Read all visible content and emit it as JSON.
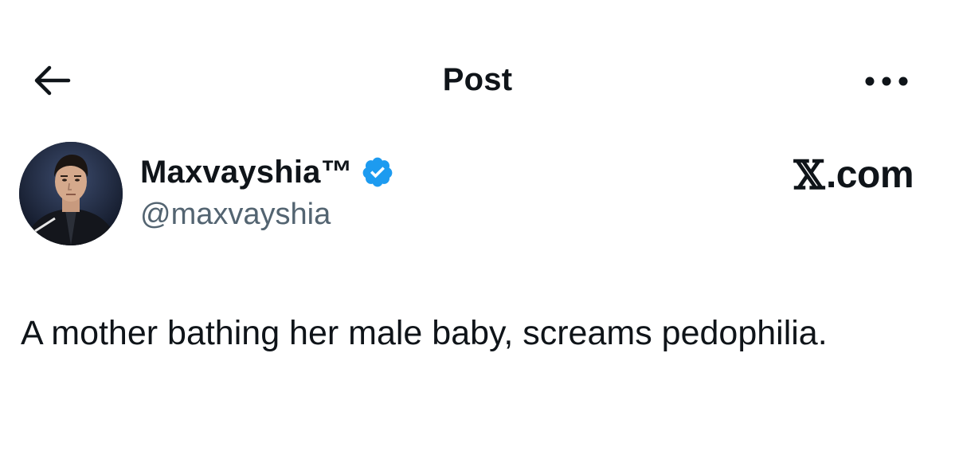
{
  "header": {
    "title": "Post",
    "back_icon": "arrow-left-icon",
    "more_icon": "more-horizontal-icon"
  },
  "author": {
    "display_name": "Maxvayshia™",
    "handle": "@maxvayshia",
    "verified_icon": "verified-badge-icon",
    "verified_color": "#1d9bf0"
  },
  "brand": {
    "label": ".com",
    "logo_letter": "𝕏"
  },
  "post": {
    "text": "A mother bathing her male baby, screams pedophilia."
  },
  "colors": {
    "text_primary": "#0f1419",
    "text_secondary": "#536471",
    "background": "#ffffff",
    "accent": "#1d9bf0"
  }
}
